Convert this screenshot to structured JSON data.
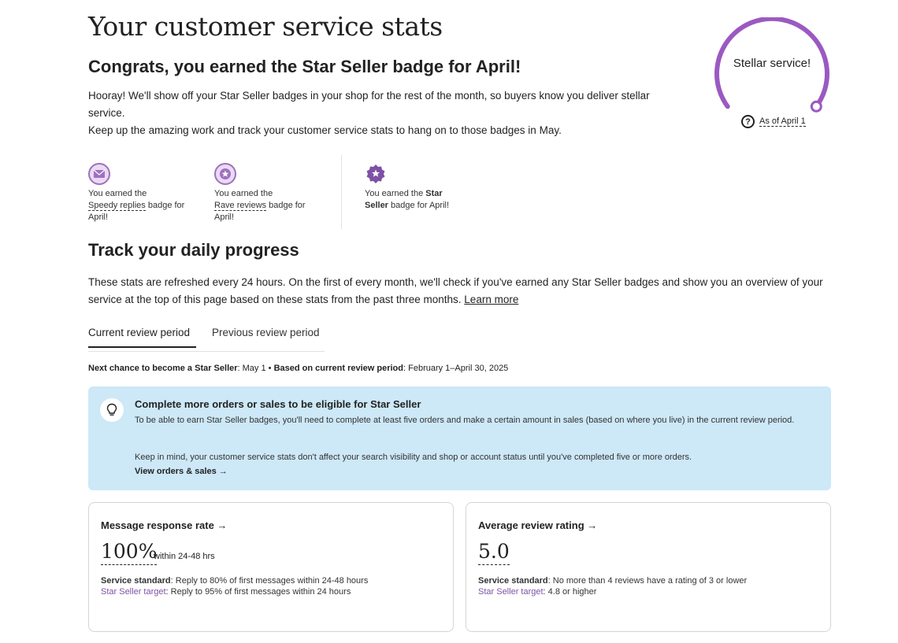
{
  "header": {
    "title": "Your customer service stats",
    "congrats": "Congrats, you earned the Star Seller badge for April!",
    "intro_line1": "Hooray! We'll show off your Star Seller badges in your shop for the rest of the month, so buyers know you deliver stellar service.",
    "intro_line2": "Keep up the amazing work and track your customer service stats to hang on to those badges in May."
  },
  "gauge": {
    "text": "Stellar service!",
    "as_of": "As of April 1",
    "color": "#9b59c2"
  },
  "badges": [
    {
      "icon": "envelope-icon",
      "prefix": "You earned the",
      "name": "Speedy replies",
      "suffix": "badge for April!"
    },
    {
      "icon": "star-icon",
      "prefix": "You earned the",
      "name": "Rave reviews",
      "suffix": "badge for April!"
    },
    {
      "icon": "star-seller-icon",
      "prefix": "You earned the",
      "name": "Star Seller",
      "suffix": "badge for April!"
    }
  ],
  "track": {
    "title": "Track your daily progress",
    "desc": "These stats are refreshed every 24 hours. On the first of every month, we'll check if you've earned any Star Seller badges and show you an overview of your service at the top of this page based on these stats from the past three months.",
    "learn_more": "Learn more"
  },
  "tabs": [
    {
      "label": "Current review period",
      "active": true
    },
    {
      "label": "Previous review period",
      "active": false
    }
  ],
  "next_chance": {
    "label1": "Next chance to become a Star Seller",
    "value1": ": May 1 • ",
    "label2": "Based on current review period",
    "value2": ": February 1–April 30, 2025"
  },
  "info": {
    "title": "Complete more orders or sales to be eligible for Star Seller",
    "p1": "To be able to earn Star Seller badges, you'll need to complete at least five orders and make a certain amount in sales (based on where you live) in the current review period.",
    "p2": "Keep in mind, your customer service stats don't affect your search visibility and shop or account status until you've completed five or more orders.",
    "link": "View orders & sales →"
  },
  "cards": [
    {
      "title": "Message response rate →",
      "value": "100%",
      "within": "within 24-48 hrs",
      "std_label": "Service standard",
      "std_text": ": Reply to 80% of first messages within 24-48 hours",
      "target_label": "Star Seller target",
      "target_text": ": Reply to 95% of first messages within 24 hours"
    },
    {
      "title": "Average review rating →",
      "value": "5.0",
      "within": "",
      "std_label": "Service standard",
      "std_text": ": No more than 4 reviews have a rating of 3 or lower",
      "target_label": "Star Seller target",
      "target_text": ": 4.8 or higher"
    }
  ],
  "colors": {
    "accent_purple": "#7f50a5",
    "info_bg": "#cde8f7"
  }
}
